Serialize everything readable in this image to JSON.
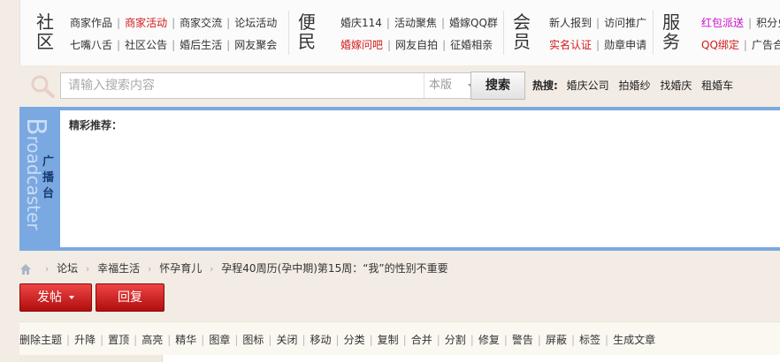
{
  "nav": {
    "groups": [
      {
        "head": [
          "社",
          "区"
        ],
        "row1": [
          {
            "t": "商家作品",
            "c": "it"
          },
          {
            "t": "商家活动",
            "c": "red"
          },
          {
            "t": "商家交流",
            "c": "it"
          },
          {
            "t": "论坛活动",
            "c": "it"
          }
        ],
        "row2": [
          {
            "t": "七嘴八舌",
            "c": "it"
          },
          {
            "t": "社区公告",
            "c": "it"
          },
          {
            "t": "婚后生活",
            "c": "it"
          },
          {
            "t": "网友聚会",
            "c": "it"
          }
        ]
      },
      {
        "head": [
          "便",
          "民"
        ],
        "row1": [
          {
            "t": "婚庆114",
            "c": "it"
          },
          {
            "t": "活动聚焦",
            "c": "it"
          },
          {
            "t": "婚嫁QQ群",
            "c": "it"
          }
        ],
        "row2": [
          {
            "t": "婚嫁问吧",
            "c": "red"
          },
          {
            "t": "网友自拍",
            "c": "it"
          },
          {
            "t": "征婚相亲",
            "c": "it"
          }
        ]
      },
      {
        "head": [
          "会",
          "员"
        ],
        "row1": [
          {
            "t": "新人报到",
            "c": "it"
          },
          {
            "t": "访问推广",
            "c": "it"
          }
        ],
        "row2": [
          {
            "t": "实名认证",
            "c": "red"
          },
          {
            "t": "勋章申请",
            "c": "it"
          }
        ]
      },
      {
        "head": [
          "服",
          "务"
        ],
        "row1": [
          {
            "t": "红包派送",
            "c": "pink"
          },
          {
            "t": "积分兑",
            "c": "it"
          }
        ],
        "row2": [
          {
            "t": "QQ绑定",
            "c": "red"
          },
          {
            "t": "广告合",
            "c": "it"
          }
        ]
      }
    ]
  },
  "search": {
    "placeholder": "请输入搜索内容",
    "scope": "本版",
    "button": "搜索",
    "hot_label": "热搜:",
    "hot_terms": [
      "婚庆公司",
      "拍婚纱",
      "找婚庆",
      "租婚车"
    ]
  },
  "broadcast": {
    "big_letter": "B",
    "big_rest": "roadcaster",
    "cn": [
      "广",
      "播",
      "台"
    ],
    "panel_title": "精彩推荐："
  },
  "breadcrumb": [
    "论坛",
    "幸福生活",
    "怀孕育儿",
    "孕程40周历(孕中期)第15周：“我”的性别不重要"
  ],
  "actions": {
    "post": "发帖",
    "reply": "回复"
  },
  "moderation": [
    "删除主题",
    "升降",
    "置顶",
    "高亮",
    "精华",
    "图章",
    "图标",
    "关闭",
    "移动",
    "分类",
    "复制",
    "合并",
    "分割",
    "修复",
    "警告",
    "屏蔽",
    "标签",
    "生成文章"
  ],
  "colors": {
    "accent_red": "#c81e1e",
    "broadcast_blue": "#7aa9e2"
  }
}
